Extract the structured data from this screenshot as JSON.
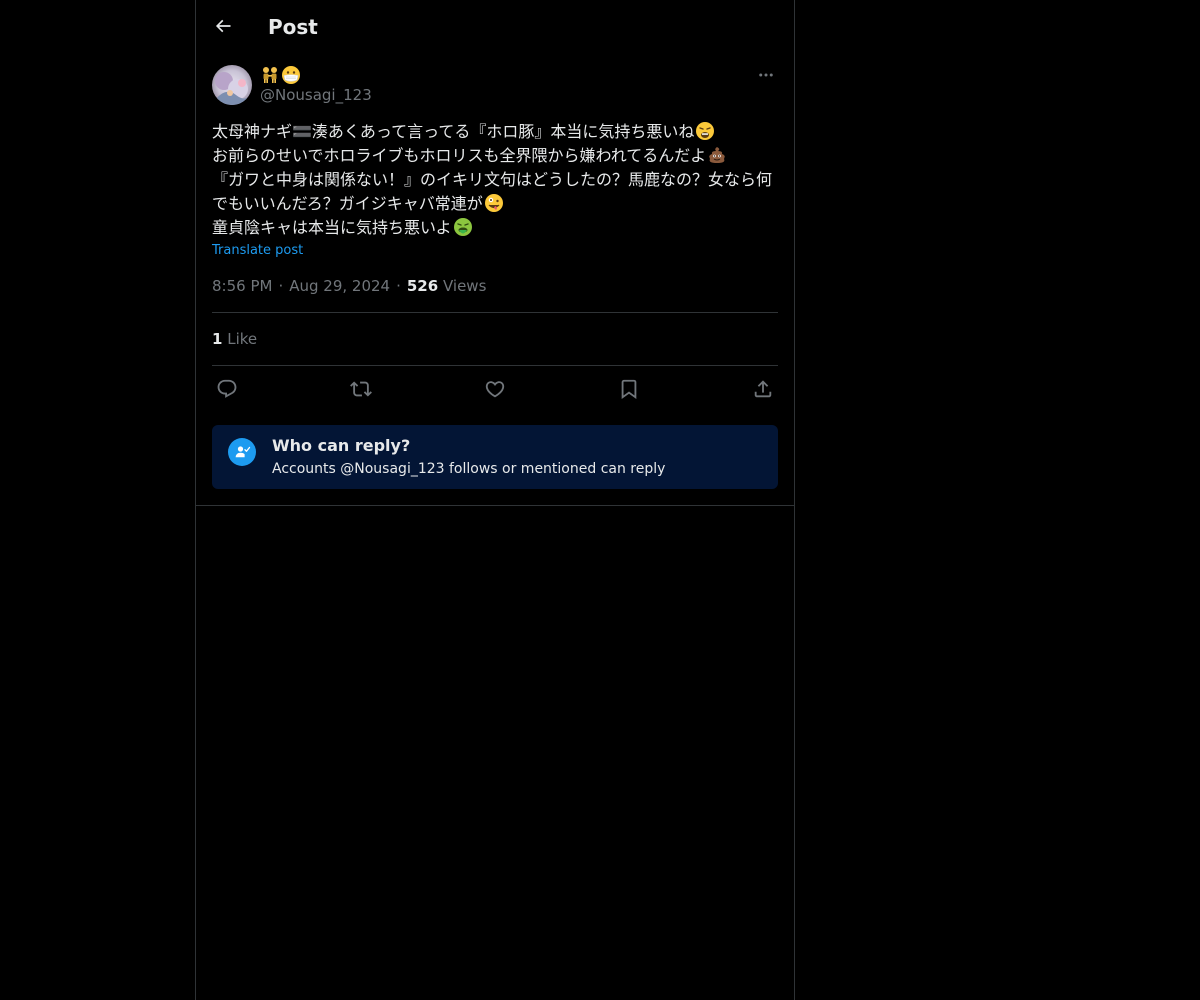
{
  "header": {
    "title": "Post"
  },
  "post": {
    "author": {
      "display_name_emojis": [
        "people-holding-hands-emoji",
        "face-with-medical-mask-emoji"
      ],
      "handle": "@Nousagi_123"
    },
    "text_lines": [
      {
        "text": "太母神ナギ🟰湊あくあって言ってる『ホロ豚』本当に気持ち悪いね",
        "emoji": "weary-face-emoji"
      },
      {
        "text": "お前らのせいでホロライブもホロリスも全界隈から嫌われてるんだよ",
        "emoji": "pile-of-poo-emoji"
      },
      {
        "text": "『ガワと中身は関係ない！』のイキリ文句はどうしたの？馬鹿なの？女なら何でもいいんだろ？ガイジキャバ常連が",
        "emoji": "zany-face-emoji"
      },
      {
        "text": "童貞陰キャは本当に気持ち悪いよ",
        "emoji": "vomiting-face-emoji"
      }
    ],
    "translate_label": "Translate post",
    "time": "8:56 PM",
    "date": "Aug 29, 2024",
    "views_count": "526",
    "views_label": "Views",
    "likes_count": "1",
    "likes_label": "Like"
  },
  "reply_restriction": {
    "title": "Who can reply?",
    "description": "Accounts @Nousagi_123 follows or mentioned can reply"
  },
  "icons": {
    "back": "arrow-left-icon",
    "more": "more-horizontal-icon",
    "reply": "reply-icon",
    "repost": "repost-icon",
    "like": "heart-icon",
    "bookmark": "bookmark-icon",
    "share": "share-icon",
    "reply_card": "person-check-icon"
  },
  "colors": {
    "background": "#000000",
    "text": "#e7e9ea",
    "muted": "#71767b",
    "accent": "#1d9bf0",
    "border": "#2f3336",
    "reply_card_bg": "#031535"
  }
}
